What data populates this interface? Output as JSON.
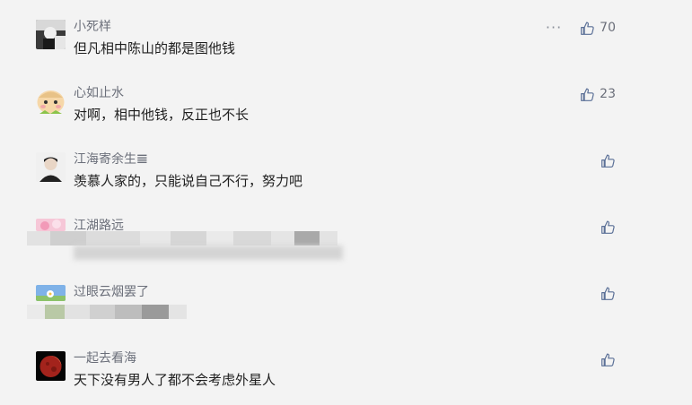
{
  "colors": {
    "background": "#f3f3f3",
    "text": "#1f1f1f",
    "meta": "#6b6f7a",
    "icon": "#5a6f96"
  },
  "comments": [
    {
      "username": "小死样",
      "text": "但凡相中陈山的都是图他钱",
      "likes": "70",
      "show_more": true,
      "blurred": false
    },
    {
      "username": "心如止水",
      "text": "对啊，相中他钱，反正也不长",
      "likes": "23",
      "show_more": false,
      "blurred": false
    },
    {
      "username": "江海寄余生𝌆",
      "text": "羡慕人家的，只能说自己不行，努力吧",
      "likes": "",
      "show_more": false,
      "blurred": false
    },
    {
      "username": "江湖路远",
      "text": "",
      "likes": "",
      "show_more": false,
      "blurred": true
    },
    {
      "username": "过眼云烟罢了",
      "text": "",
      "likes": "",
      "show_more": false,
      "blurred": true
    },
    {
      "username": "一起去看海",
      "text": "天下没有男人了都不会考虑外星人",
      "likes": "",
      "show_more": false,
      "blurred": false
    }
  ],
  "more_label": "···"
}
